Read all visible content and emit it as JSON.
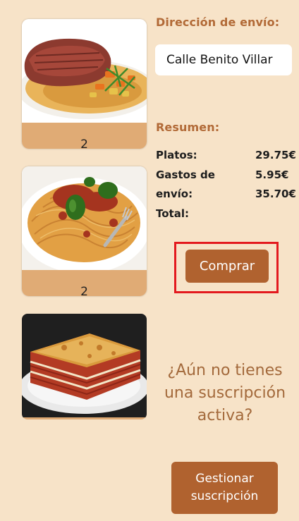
{
  "dishes": [
    {
      "image": "steak-dish-photo",
      "quantity": "2"
    },
    {
      "image": "spaghetti-dish-photo",
      "quantity": "2"
    },
    {
      "image": "lasagna-dish-photo"
    }
  ],
  "shipping": {
    "title": "Dirección de envío:",
    "address_value": "Calle Benito Villar"
  },
  "summary": {
    "title": "Resumen:",
    "labels": [
      "Platos:",
      "Gastos de",
      "envío:",
      "Total:"
    ],
    "values": [
      "29.75€",
      "5.95€",
      "35.70€"
    ]
  },
  "buy_button": {
    "label": "Comprar",
    "highlight_color": "#e3191e"
  },
  "subscription": {
    "promo_text": "¿Aún no tienes una suscripción activa?",
    "manage_label": "Gestionar\nsuscripción"
  },
  "colors": {
    "background": "#f7e3c8",
    "accent": "#b0622f",
    "title": "#b26a37",
    "qty_bar": "#e0ab75"
  }
}
